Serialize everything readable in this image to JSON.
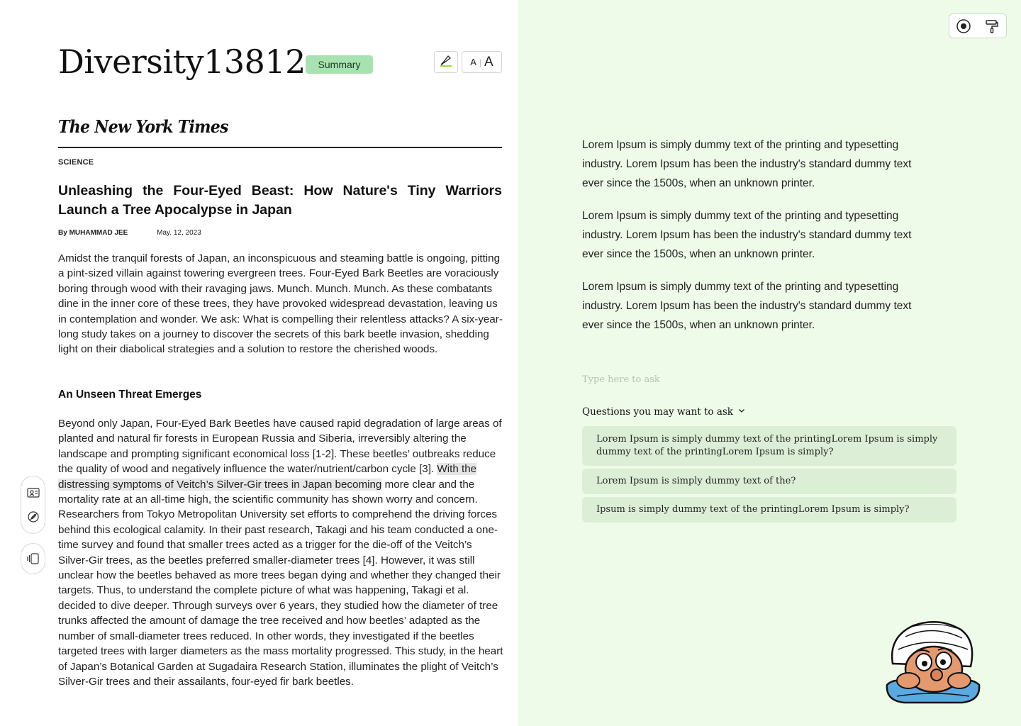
{
  "document": {
    "title": "Diversity13812.",
    "badge": "Summary",
    "font_size_small": "A",
    "font_size_separator": "|",
    "font_size_large": "A"
  },
  "article": {
    "publication": "The New York Times",
    "section": "SCIENCE",
    "headline": "Unleashing the Four-Eyed Beast: How Nature's Tiny Warriors Launch a Tree Apocalypse in Japan",
    "byline_prefix": "By",
    "author": "MUHAMMAD JEE",
    "date": "May. 12, 2023",
    "paragraph1": "Amidst the tranquil forests of Japan, an inconspicuous and steaming battle is ongoing, pitting a pint-sized villain against towering evergreen trees. Four-Eyed Bark Beetles are voraciously boring through wood with their ravaging jaws. Munch. Munch. Munch. As these combatants dine in the inner core of these trees, they have provoked widespread devastation, leaving us in contemplation and wonder. We ask: What is compelling their relentless attacks? A six-year-long study takes on a journey to discover the secrets of this bark beetle invasion, shedding light on their diabolical strategies and a solution to restore the cherished woods.",
    "subheading": "An Unseen Threat Emerges",
    "paragraph2_before": "Beyond only Japan, Four-Eyed Bark Beetles have caused rapid degradation of large areas of planted and natural fir forests in European Russia and Siberia, irreversibly altering the landscape and prompting significant economical loss  [1-2]. These beetles’ outbreaks reduce the quality of wood and negatively influence the water/nutrient/carbon cycle [3]. ",
    "paragraph2_highlight": "With the distressing symptoms of Veitch’s Silver-Gir trees in Japan becoming",
    "paragraph2_after": " more clear and the mortality rate at an all-time high, the scientific community has shown worry and concern. Researchers from Tokyo Metropolitan University set efforts to comprehend the driving forces behind this ecological calamity. In their past research, Takagi and his team conducted a one-time survey and found that smaller trees acted as a trigger for the die-off of the Veitch’s Silver-Gir trees, as the beetles preferred smaller-diameter trees [4]. However, it was still unclear how the beetles behaved as more trees began dying and whether they changed their targets. Thus, to understand the complete picture of what was happening, Takagi et al. decided to dive deeper. Through surveys over 6 years, they studied how the diameter of tree trunks affected the amount of damage the tree received and how beetles’ adapted as the number of small-diameter trees reduced. In other words, they investigated if the beetles targeted trees with larger diameters as the mass mortality progressed. This study, in the heart of Japan’s Botanical Garden at Sugadaira Research Station, illuminates the plight of Veitch’s Silver-Gir trees and their assailants, four-eyed fir bark beetles."
  },
  "summary": {
    "paragraphs": [
      "Lorem Ipsum is simply dummy text of the printing and typesetting industry. Lorem Ipsum has been the industry's standard dummy text ever since the 1500s, when an unknown printer.",
      "Lorem Ipsum is simply dummy text of the printing and typesetting industry. Lorem Ipsum has been the industry's standard dummy text ever since the 1500s, when an unknown printer.",
      "Lorem Ipsum is simply dummy text of the printing and typesetting industry. Lorem Ipsum has been the industry's standard dummy text ever since the 1500s, when an unknown printer."
    ]
  },
  "ask": {
    "placeholder": "Type here to ask",
    "suggestions_header": "Questions you may want to ask",
    "suggestions": [
      "Lorem Ipsum is simply dummy text of the printingLorem Ipsum is simply dummy text of the printingLorem Ipsum is simply?",
      "Lorem Ipsum is simply dummy text of the?",
      "Ipsum is simply dummy text of the printingLorem Ipsum is simply?"
    ]
  },
  "icons": {
    "highlighter": "highlighter-icon",
    "record": "record-icon",
    "paint_roller": "paint-roller-icon",
    "person_card": "person-card-icon",
    "no_edit": "no-edit-icon",
    "panel_toggle": "panel-toggle-icon",
    "chevron": "chevron-down-icon"
  },
  "colors": {
    "right_pane_bg": "#edfbe8",
    "badge_bg": "#a9e2b1",
    "suggestion_bg": "#dcefd6",
    "highlight_bg": "#e6e6e6"
  }
}
